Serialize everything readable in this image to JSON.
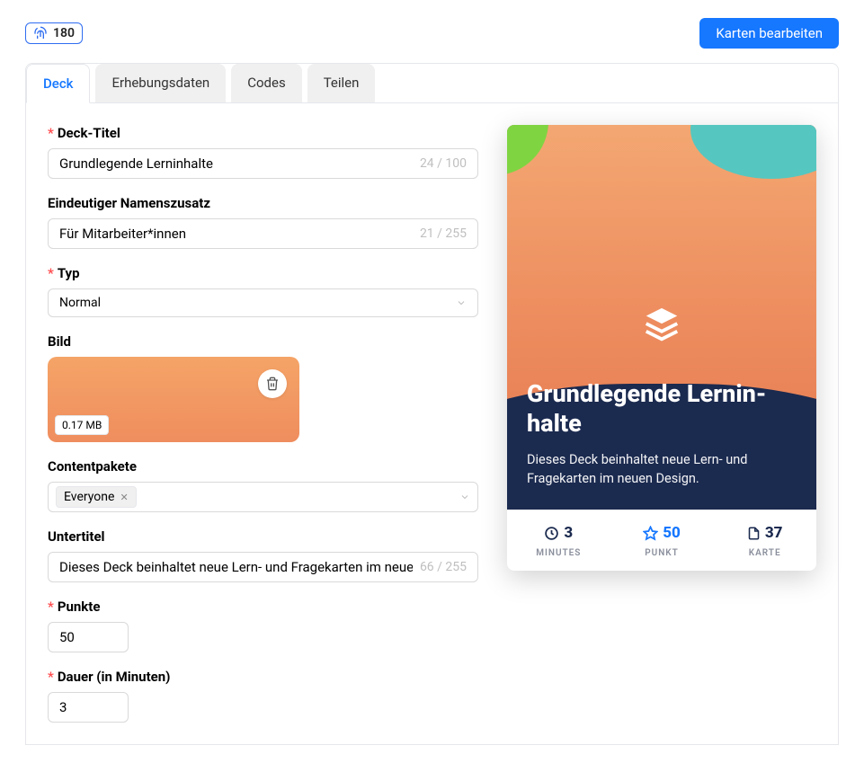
{
  "header": {
    "badge_count": "180",
    "edit_button": "Karten bearbeiten"
  },
  "tabs": [
    "Deck",
    "Erhebungsdaten",
    "Codes",
    "Teilen"
  ],
  "form": {
    "title": {
      "label": "Deck-Titel",
      "value": "Grundlegende Lerninhalte",
      "counter": "24 / 100"
    },
    "unique": {
      "label": "Eindeutiger Namenszusatz",
      "value": "Für Mitarbeiter*innen",
      "counter": "21 / 255"
    },
    "type": {
      "label": "Typ",
      "value": "Normal"
    },
    "image": {
      "label": "Bild",
      "size": "0.17 MB"
    },
    "packs": {
      "label": "Contentpakete",
      "tag": "Everyone"
    },
    "subtitle": {
      "label": "Untertitel",
      "value": "Dieses Deck beinhaltet neue Lern- und Fragekarten im neuen Design.",
      "counter": "66 / 255"
    },
    "points": {
      "label": "Punkte",
      "value": "50"
    },
    "duration": {
      "label": "Dauer (in Minuten)",
      "value": "3"
    }
  },
  "preview": {
    "title": "Grundlegende Lernin­halte",
    "subtitle": "Dieses Deck beinhaltet neue Lern- und Fragekarten im neuen Design.",
    "stats": {
      "minutes": {
        "value": "3",
        "label": "MINUTES"
      },
      "points": {
        "value": "50",
        "label": "PUNKT"
      },
      "cards": {
        "value": "37",
        "label": "KARTE"
      }
    }
  }
}
